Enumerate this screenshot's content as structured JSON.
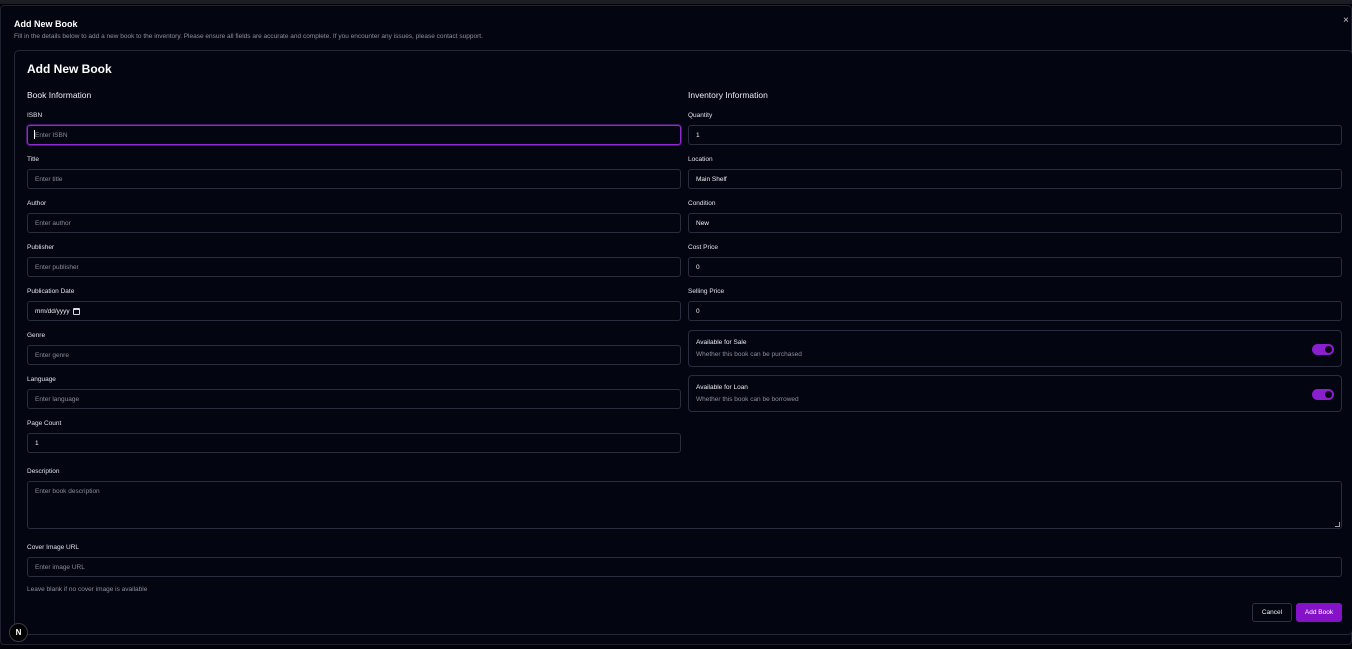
{
  "dialog": {
    "title": "Add New Book",
    "description": "Fill in the details below to add a new book to the inventory. Please ensure all fields are accurate and complete. If you encounter any issues, please contact support.",
    "close_glyph": "×"
  },
  "form": {
    "title": "Add New Book",
    "book_section": "Book Information",
    "inventory_section": "Inventory Information",
    "isbn": {
      "label": "ISBN",
      "placeholder": "Enter ISBN",
      "value": ""
    },
    "title_field": {
      "label": "Title",
      "placeholder": "Enter title",
      "value": ""
    },
    "author": {
      "label": "Author",
      "placeholder": "Enter author",
      "value": ""
    },
    "publisher": {
      "label": "Publisher",
      "placeholder": "Enter publisher",
      "value": ""
    },
    "publication_date": {
      "label": "Publication Date",
      "value": "mm/dd/yyyy"
    },
    "genre": {
      "label": "Genre",
      "placeholder": "Enter genre",
      "value": ""
    },
    "language": {
      "label": "Language",
      "placeholder": "Enter language",
      "value": ""
    },
    "page_count": {
      "label": "Page Count",
      "value": "1"
    },
    "quantity": {
      "label": "Quantity",
      "value": "1"
    },
    "location": {
      "label": "Location",
      "value": "Main Shelf"
    },
    "condition": {
      "label": "Condition",
      "value": "New"
    },
    "cost_price": {
      "label": "Cost Price",
      "value": "0"
    },
    "selling_price": {
      "label": "Selling Price",
      "value": "0"
    },
    "available_sale": {
      "title": "Available for Sale",
      "subtitle": "Whether this book can be purchased",
      "on": true
    },
    "available_loan": {
      "title": "Available for Loan",
      "subtitle": "Whether this book can be borrowed",
      "on": true
    },
    "description": {
      "label": "Description",
      "placeholder": "Enter book description",
      "value": ""
    },
    "cover_image": {
      "label": "Cover Image URL",
      "placeholder": "Enter image URL",
      "value": "",
      "hint": "Leave blank if no cover image is available"
    },
    "cancel_label": "Cancel",
    "submit_label": "Add Book"
  },
  "badge": {
    "letter": "N"
  },
  "colors": {
    "accent": "#8512c8",
    "background": "#030510",
    "border": "#2a2d3d"
  }
}
